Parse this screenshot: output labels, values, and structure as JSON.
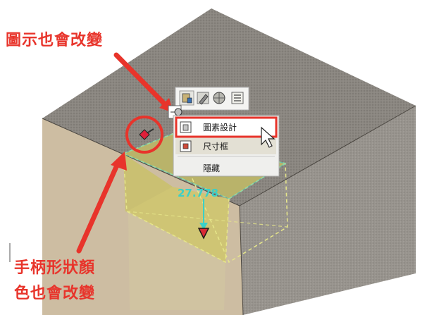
{
  "annotations": {
    "icon_change": "圖示也會改變",
    "handle_change_line1": "手柄形狀顏",
    "handle_change_line2": "色也會改變"
  },
  "context_menu": {
    "items": [
      {
        "label": "圖素設計",
        "icon": "feature-design-icon",
        "highlighted": true
      },
      {
        "label": "尺寸框",
        "icon": "size-box-icon",
        "highlighted": false
      },
      {
        "label": "隱藏",
        "icon": "",
        "highlighted": false
      }
    ]
  },
  "toolbar": {
    "buttons": [
      "feature-tool-icon",
      "edit-icon",
      "globe-icon",
      "list-icon"
    ]
  },
  "dimension": {
    "value": "27.778"
  },
  "colors": {
    "annotation": "#e8342b",
    "dimension": "#3ad0c8",
    "block_top": "#8a8680",
    "block_side": "#c9b89d",
    "pocket": "#cbc36a"
  }
}
